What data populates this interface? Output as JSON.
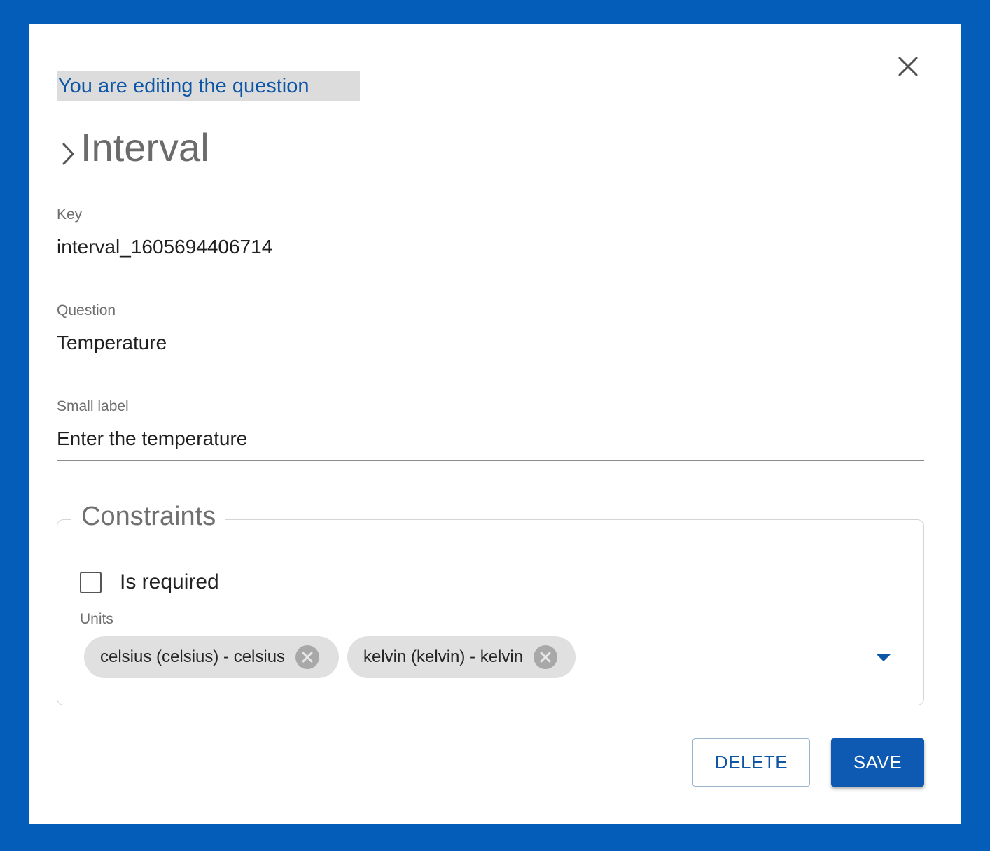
{
  "dialog": {
    "banner": "You are editing the question",
    "title": "Interval",
    "close_icon": "close-icon",
    "title_icon": "chevron-right-icon"
  },
  "fields": {
    "key": {
      "label": "Key",
      "value": "interval_1605694406714"
    },
    "question": {
      "label": "Question",
      "value": "Temperature"
    },
    "small_label": {
      "label": "Small label",
      "value": "Enter the temperature"
    }
  },
  "constraints": {
    "legend": "Constraints",
    "is_required": {
      "label": "Is required",
      "checked": false
    },
    "units": {
      "label": "Units",
      "selected": [
        {
          "label": "celsius (celsius) - celsius"
        },
        {
          "label": "kelvin (kelvin) - kelvin"
        }
      ]
    }
  },
  "actions": {
    "delete_label": "DELETE",
    "save_label": "SAVE"
  },
  "colors": {
    "background": "#055dba",
    "accent": "#0e5ab2",
    "banner_bg": "#dcdcdc",
    "banner_text": "#0d56a6"
  }
}
